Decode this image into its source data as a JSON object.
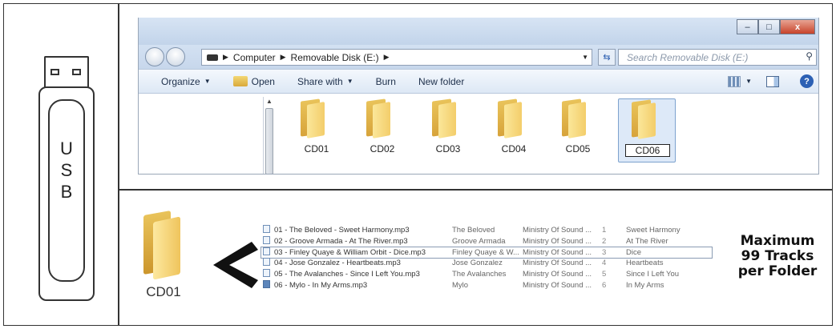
{
  "usb": {
    "label_letters": [
      "U",
      "S",
      "B"
    ]
  },
  "explorer": {
    "window_buttons": {
      "minimize": "–",
      "maximize": "□",
      "close": "x"
    },
    "address": {
      "crumbs": [
        "Computer",
        "Removable Disk (E:)"
      ]
    },
    "search": {
      "placeholder": "Search Removable Disk (E:)"
    },
    "toolbar": {
      "organize": "Organize",
      "open": "Open",
      "share_with": "Share with",
      "burn": "Burn",
      "new_folder": "New folder"
    },
    "folders": [
      {
        "label": "CD01"
      },
      {
        "label": "CD02"
      },
      {
        "label": "CD03"
      },
      {
        "label": "CD04"
      },
      {
        "label": "CD05"
      },
      {
        "label": "CD06",
        "renaming": true
      }
    ]
  },
  "folder_view": {
    "folder_label": "CD01",
    "tracks": [
      {
        "name": "01 - The Beloved - Sweet Harmony.mp3",
        "artist": "The Beloved",
        "album": "Ministry Of Sound ...",
        "num": "1",
        "title": "Sweet Harmony"
      },
      {
        "name": "02 - Groove Armada - At The River.mp3",
        "artist": "Groove Armada",
        "album": "Ministry Of Sound ...",
        "num": "2",
        "title": "At The River"
      },
      {
        "name": "03 - Finley Quaye & William Orbit - Dice.mp3",
        "artist": "Finley Quaye & W...",
        "album": "Ministry Of Sound ...",
        "num": "3",
        "title": "Dice"
      },
      {
        "name": "04 - Jose Gonzalez - Heartbeats.mp3",
        "artist": "Jose Gonzalez",
        "album": "Ministry Of Sound ...",
        "num": "4",
        "title": "Heartbeats"
      },
      {
        "name": "05 - The Avalanches - Since I Left You.mp3",
        "artist": "The Avalanches",
        "album": "Ministry Of Sound ...",
        "num": "5",
        "title": "Since I Left You"
      },
      {
        "name": "06 - Mylo - In My Arms.mp3",
        "artist": "Mylo",
        "album": "Ministry Of Sound ...",
        "num": "6",
        "title": "In My Arms"
      }
    ],
    "note_lines": [
      "Maximum",
      "99 Tracks",
      "per Folder"
    ]
  }
}
